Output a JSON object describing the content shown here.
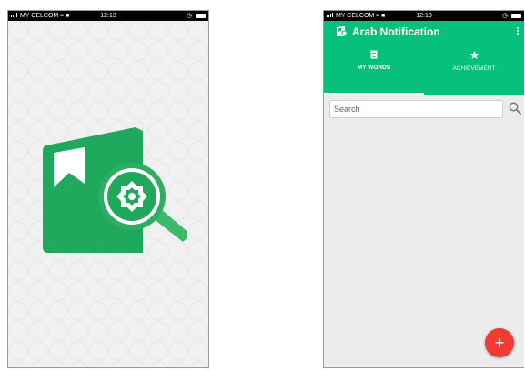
{
  "status_bar": {
    "carrier": "MY CELCOM",
    "time": "12:13"
  },
  "app": {
    "title": "Arab Notification",
    "tabs": [
      {
        "label": "MY WORDS",
        "icon": "document-icon",
        "active": true
      },
      {
        "label": "ACHIEVEMENT",
        "icon": "star-icon",
        "active": false
      }
    ],
    "search": {
      "value": "",
      "placeholder": "Search"
    },
    "fab_label": "+"
  },
  "colors": {
    "primary": "#07c07b",
    "accent": "#ef3b34",
    "splash_background": "#f1f1f1",
    "content_background": "#ececec"
  },
  "icons": {
    "splash_logo": "book-magnifier-logo",
    "search": "search-icon",
    "menu": "overflow-menu-icon"
  }
}
